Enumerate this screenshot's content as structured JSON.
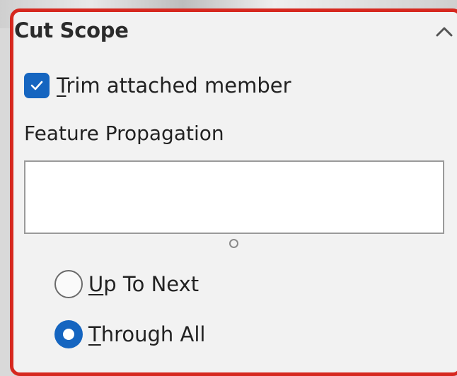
{
  "section": {
    "title": "Cut Scope"
  },
  "trim_checkbox": {
    "label": "Trim attached member",
    "mnemonic": "T",
    "rest": "rim attached member",
    "checked": true
  },
  "feature_propagation": {
    "label": "Feature Propagation",
    "value": ""
  },
  "radio_options": [
    {
      "label": "Up To Next",
      "mnemonic": "U",
      "rest": "p To Next",
      "selected": false
    },
    {
      "label": "Through All",
      "mnemonic": "T",
      "rest": "hrough All",
      "selected": true
    }
  ],
  "colors": {
    "accent": "#1565c0",
    "highlight_border": "#d6281f",
    "panel_bg": "#f2f2f2"
  },
  "icons": {
    "collapse": "chevron-up-icon",
    "check": "checkmark-icon"
  }
}
